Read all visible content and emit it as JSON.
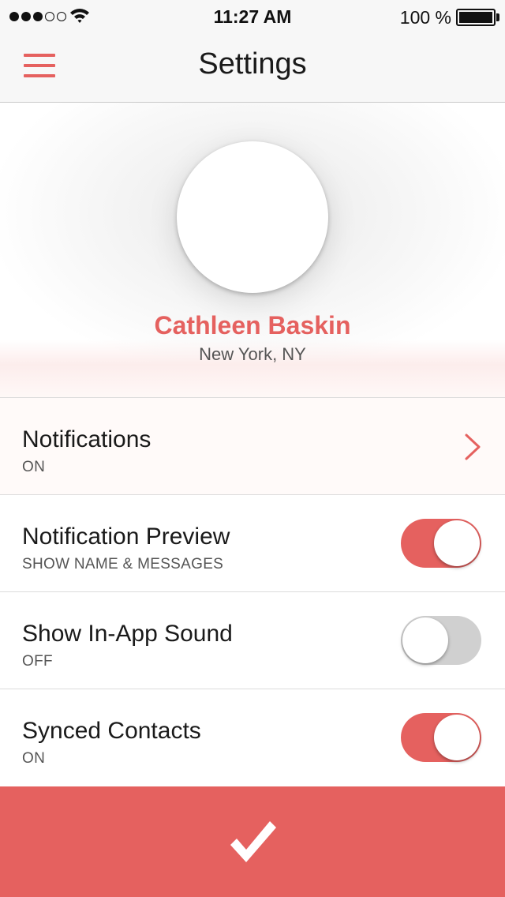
{
  "status_bar": {
    "signal_filled": 3,
    "signal_total": 5,
    "time": "11:27 AM",
    "battery_text": "100 %",
    "battery_level": 1.0
  },
  "nav": {
    "title": "Settings",
    "menu_icon": "hamburger-menu-icon"
  },
  "profile": {
    "name": "Cathleen Baskin",
    "location": "New York, NY"
  },
  "settings": [
    {
      "title": "Notifications",
      "subtitle": "ON",
      "control": "chevron"
    },
    {
      "title": "Notification Preview",
      "subtitle": "SHOW NAME & MESSAGES",
      "control": "toggle",
      "on": true
    },
    {
      "title": "Show In-App Sound",
      "subtitle": "OFF",
      "control": "toggle",
      "on": false
    },
    {
      "title": "Synced Contacts",
      "subtitle": "ON",
      "control": "toggle",
      "on": true
    }
  ],
  "colors": {
    "accent": "#e5615f",
    "toggle_off": "#d0d0d0"
  },
  "confirm_icon": "checkmark-icon"
}
